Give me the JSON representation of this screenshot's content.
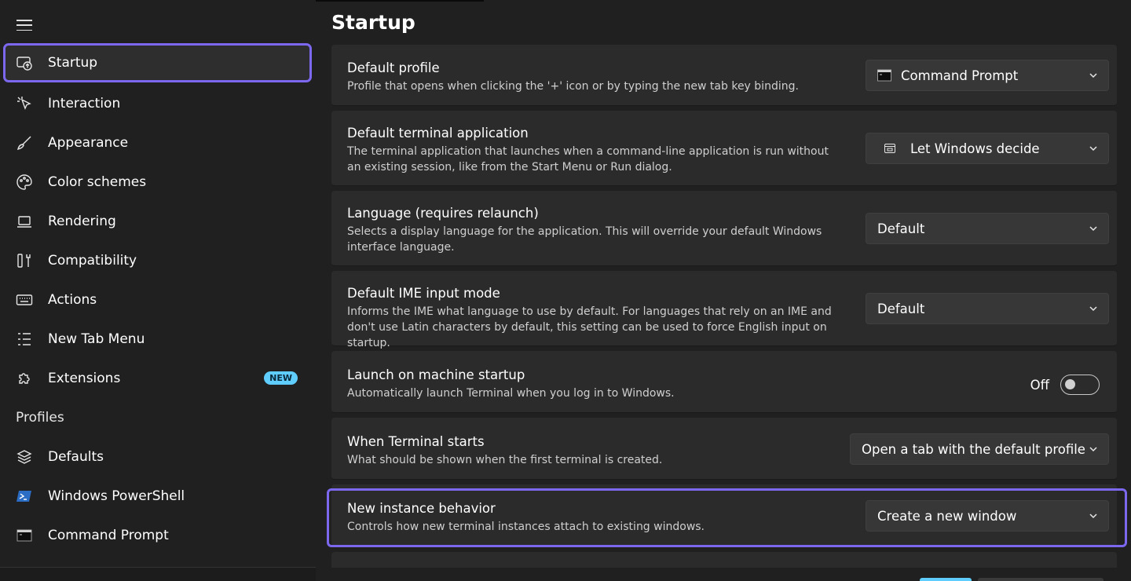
{
  "sidebar": {
    "items": [
      {
        "label": "Startup",
        "icon": "startup-icon"
      },
      {
        "label": "Interaction",
        "icon": "cursor-icon"
      },
      {
        "label": "Appearance",
        "icon": "brush-icon"
      },
      {
        "label": "Color schemes",
        "icon": "palette-icon"
      },
      {
        "label": "Rendering",
        "icon": "laptop-icon"
      },
      {
        "label": "Compatibility",
        "icon": "tools-icon"
      },
      {
        "label": "Actions",
        "icon": "keyboard-icon"
      },
      {
        "label": "New Tab Menu",
        "icon": "list-icon"
      },
      {
        "label": "Extensions",
        "icon": "puzzle-icon",
        "badge": "NEW"
      }
    ],
    "profiles_header": "Profiles",
    "profiles": [
      {
        "label": "Defaults",
        "icon": "layers-icon"
      },
      {
        "label": "Windows PowerShell",
        "icon": "powershell-icon"
      },
      {
        "label": "Command Prompt",
        "icon": "cmd-icon"
      }
    ]
  },
  "main": {
    "title": "Startup",
    "settings": [
      {
        "title": "Default profile",
        "desc": "Profile that opens when clicking the '+' icon or by typing the new tab key binding.",
        "value": "Command Prompt"
      },
      {
        "title": "Default terminal application",
        "desc": "The terminal application that launches when a command-line application is run without an existing session, like from the Start Menu or Run dialog.",
        "value": "Let Windows decide"
      },
      {
        "title": "Language (requires relaunch)",
        "desc": "Selects a display language for the application. This will override your default Windows interface language.",
        "value": "Default"
      },
      {
        "title": "Default IME input mode",
        "desc": "Informs the IME what language to use by default. For languages that rely on an IME and don't use Latin characters by default, this setting can be used to force English input on startup.",
        "value": "Default"
      },
      {
        "title": "Launch on machine startup",
        "desc": "Automatically launch Terminal when you log in to Windows.",
        "value": "Off"
      },
      {
        "title": "When Terminal starts",
        "desc": "What should be shown when the first terminal is created.",
        "value": "Open a tab with the default profile"
      },
      {
        "title": "New instance behavior",
        "desc": "Controls how new terminal instances attach to existing windows.",
        "value": "Create a new window"
      }
    ]
  },
  "colors": {
    "accent": "#7b68ee",
    "badge": "#60cdff",
    "background": "#202020",
    "card": "#2b2b2b"
  }
}
